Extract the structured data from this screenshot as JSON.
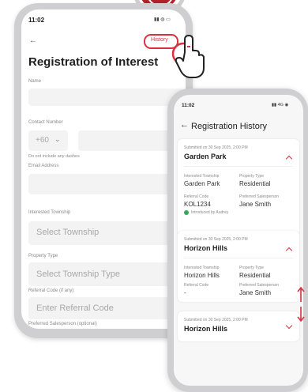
{
  "form": {
    "time": "11:02",
    "history_label": "History",
    "title": "Registration of Interest",
    "name_label": "Name",
    "contact_label": "Contact Number",
    "country_code": "+60",
    "contact_hint": "Do not include any dashes",
    "email_label": "Email Address",
    "township_label": "Interested Township",
    "township_placeholder": "Select Township",
    "property_label": "Property Type",
    "property_placeholder": "Select Township Type",
    "referral_label": "Referral Code (if any)",
    "referral_placeholder": "Enter Referral Code",
    "salesperson_label": "Preferred Salesperson (optional)"
  },
  "history": {
    "time": "11:02",
    "signal": "4G",
    "title": "Registration History",
    "labels": {
      "township": "Interested Township",
      "property": "Property Type",
      "referral": "Referral Code",
      "salesperson": "Preferred Salesperson"
    },
    "cards": [
      {
        "submitted": "Submitted on 30 Sep 2025, 2:00 PM",
        "name": "Garden Park",
        "township": "Garden Park",
        "property": "Residential",
        "referral": "KOL1234",
        "salesperson": "Jane Smith",
        "introduced": "Introduced by Audrey"
      },
      {
        "submitted": "Submitted on 30 Sep 2025, 2:00 PM",
        "name": "Horizon Hills",
        "township": "Horizon Hills",
        "property": "Residential",
        "referral": "-",
        "salesperson": "Jane Smith"
      },
      {
        "submitted": "Submitted on 30 Sep 2025, 2:00 PM",
        "name": "Horizon Hills"
      }
    ]
  },
  "colors": {
    "accent": "#d9323f",
    "badge": "#b3212e",
    "green": "#3aa757"
  }
}
